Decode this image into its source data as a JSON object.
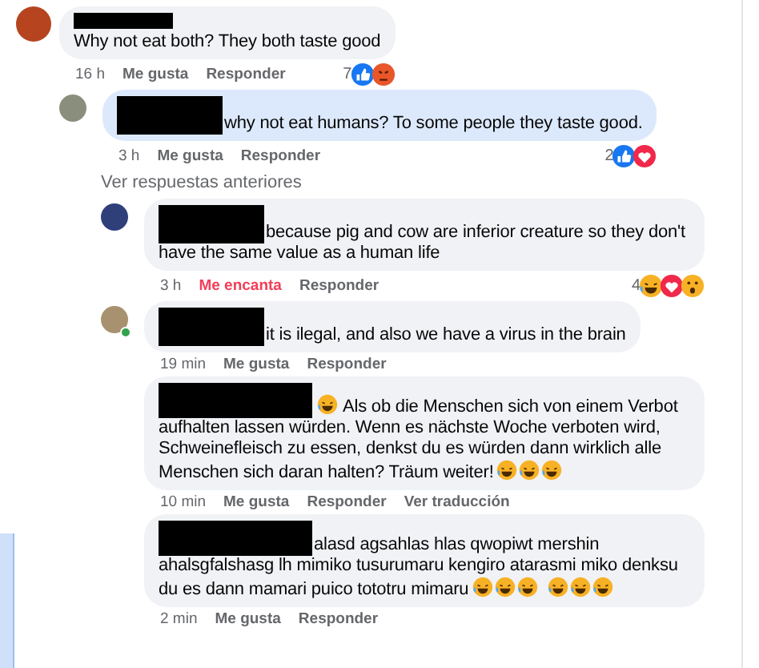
{
  "comments": [
    {
      "kind": "name_above",
      "avatar": true,
      "text": "Why not eat both? They both taste good",
      "time": "16 h",
      "actions": [
        {
          "label": "Me gusta",
          "active": false
        },
        {
          "label": "Responder",
          "active": false
        }
      ],
      "reaction_count": "7",
      "reactions": [
        {
          "kind": "like"
        },
        {
          "kind": "angry"
        }
      ],
      "children": [
        {
          "kind": "name_inline",
          "avatar": true,
          "highlighted": true,
          "text": "why not eat humans? To some people they taste good.",
          "time": "3 h",
          "actions": [
            {
              "label": "Me gusta",
              "active": false
            },
            {
              "label": "Responder",
              "active": false
            }
          ],
          "reaction_count": "2",
          "reactions": [
            {
              "kind": "like"
            },
            {
              "kind": "love"
            }
          ],
          "more_replies": "Ver respuestas anteriores",
          "children": [
            {
              "kind": "name_inline",
              "avatar": true,
              "text": "because pig and cow are inferior creature so they don't have the same value as a human life",
              "time": "3 h",
              "actions": [
                {
                  "label": "Me encanta",
                  "active": true
                },
                {
                  "label": "Responder",
                  "active": false
                }
              ],
              "reaction_count": "4",
              "reactions": [
                {
                  "kind": "haha"
                },
                {
                  "kind": "love"
                },
                {
                  "kind": "wow"
                }
              ]
            },
            {
              "kind": "name_inline",
              "avatar": true,
              "online": true,
              "text": "it is ilegal, and also we have a virus in the brain",
              "time": "19 min",
              "actions": [
                {
                  "label": "Me gusta",
                  "active": false
                },
                {
                  "label": "Responder",
                  "active": false
                }
              ]
            },
            {
              "kind": "name_wide",
              "text": "Als ob die Menschen sich von einem Verbot aufhalten lassen würden. Wenn es nächste Woche verboten wird, Schweinefleisch zu essen, denkst du es würden dann wirklich alle Menschen sich daran halten? Träum weiter!",
              "emojis_before": [
                {
                  "kind": "joy"
                }
              ],
              "emojis_after": [
                {
                  "kind": "rofl"
                },
                {
                  "kind": "rofl"
                },
                {
                  "kind": "rofl"
                }
              ],
              "time": "10 min",
              "actions": [
                {
                  "label": "Me gusta",
                  "active": false
                },
                {
                  "label": "Responder",
                  "active": false
                },
                {
                  "label": "Ver traducción",
                  "active": false
                }
              ]
            },
            {
              "kind": "name_wide",
              "text": "alasd agsahlas hlas qwopiwt mershin ahalsgfalshasg lh mimiko tusurumaru kengiro atarasmi miko denksu du es dann mamari puico tototru mimaru",
              "emojis_after": [
                {
                  "kind": "rofl"
                },
                {
                  "kind": "rofl"
                },
                {
                  "kind": "rofl"
                },
                {
                  "kind": "space"
                },
                {
                  "kind": "rofl"
                },
                {
                  "kind": "rofl"
                },
                {
                  "kind": "rofl"
                }
              ],
              "time": "2 min",
              "actions": [
                {
                  "label": "Me gusta",
                  "active": false
                },
                {
                  "label": "Responder",
                  "active": false
                }
              ]
            }
          ]
        }
      ]
    }
  ]
}
